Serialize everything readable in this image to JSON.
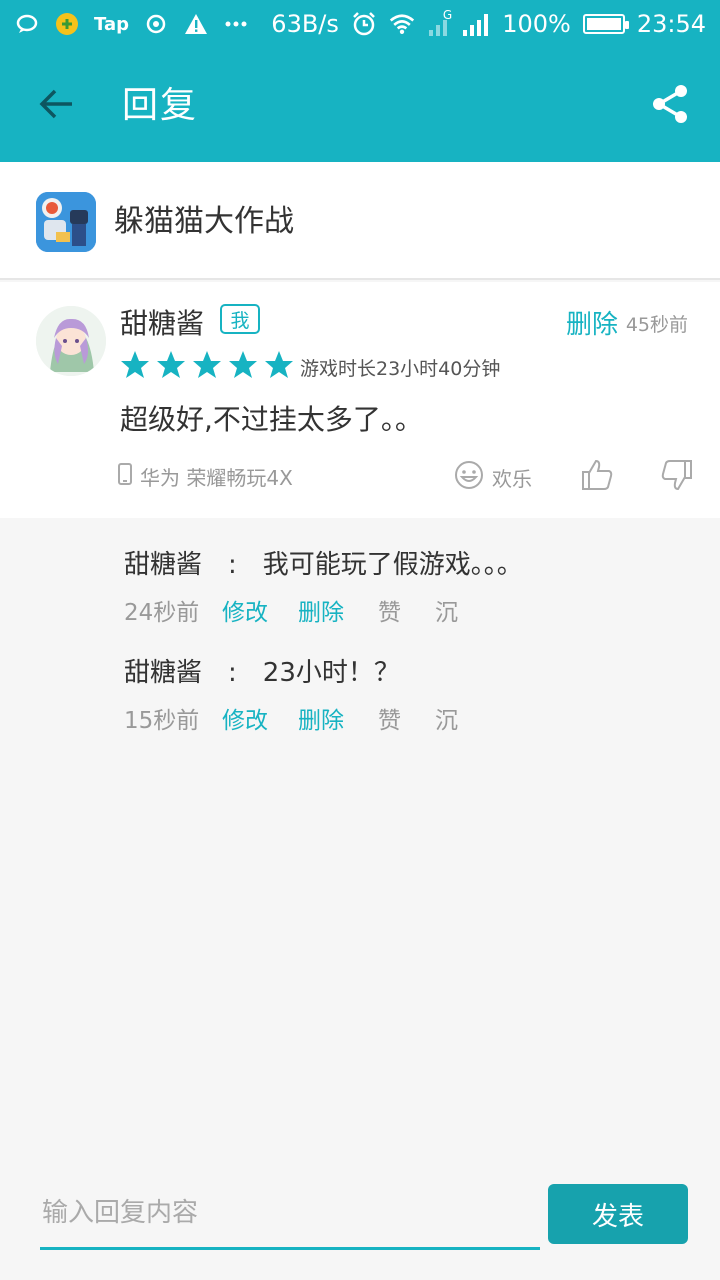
{
  "status_bar": {
    "carrier_app": "Tap",
    "net_speed": "63B/s",
    "network_type": "G",
    "battery": "100%",
    "battery_level": 1.0,
    "time": "23:54",
    "icons": [
      "chat-icon",
      "app-icon",
      "tap-icon",
      "sync-icon",
      "warning-icon",
      "more-icon",
      "alarm-icon",
      "wifi-icon",
      "signal-icon",
      "battery-icon"
    ]
  },
  "header": {
    "title": "回复",
    "back_icon": "back-arrow-icon",
    "share_icon": "share-icon"
  },
  "game": {
    "name": "躲猫猫大作战"
  },
  "review": {
    "username": "甜糖酱",
    "badge": "我",
    "delete_label": "删除",
    "time": "45秒前",
    "rating": 5,
    "playtime": "游戏时长23小时40分钟",
    "content": "超级好,不过挂太多了。。",
    "device": "华为 荣耀畅玩4X",
    "mood": "欢乐"
  },
  "replies": [
    {
      "author": "甜糖酱",
      "colon": ":",
      "text": "我可能玩了假游戏。。。",
      "time": "24秒前",
      "edit_label": "修改",
      "delete_label": "删除",
      "like_label": "赞",
      "sink_label": "沉"
    },
    {
      "author": "甜糖酱",
      "colon": ":",
      "text": "23小时！？",
      "time": "15秒前",
      "edit_label": "修改",
      "delete_label": "删除",
      "like_label": "赞",
      "sink_label": "沉"
    }
  ],
  "composer": {
    "placeholder": "输入回复内容",
    "send_label": "发表"
  },
  "colors": {
    "accent": "#17b3c2",
    "send_button": "#17a2ad",
    "background": "#f6f6f6"
  }
}
